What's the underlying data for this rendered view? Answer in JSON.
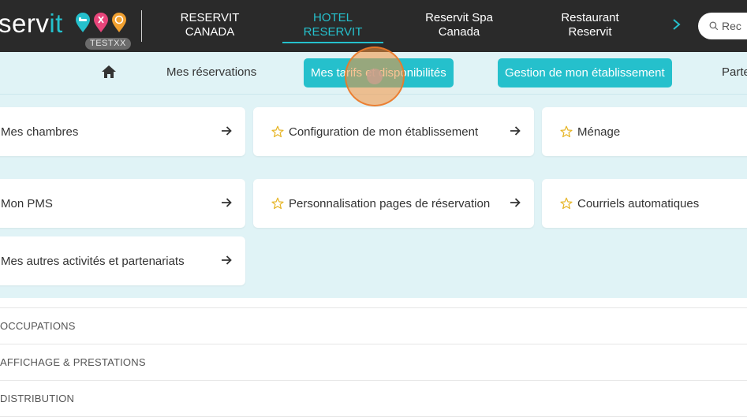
{
  "header": {
    "logo_text_main": "serv",
    "logo_text_accent": "it",
    "badge": "TESTXX",
    "nav": [
      {
        "line1": "RESERVIT",
        "line2": "CANADA",
        "active": false
      },
      {
        "line1": "HOTEL",
        "line2": "RESERVIT",
        "active": true
      },
      {
        "line1": "Reservit Spa",
        "line2": "Canada",
        "active": false
      },
      {
        "line1": "Restaurant",
        "line2": "Reservit",
        "active": false
      }
    ],
    "search_placeholder": "Rec",
    "colors": {
      "bar": "#2a2a2a",
      "accent": "#25c0cc"
    }
  },
  "subnav": {
    "home_icon": "home-icon",
    "my_reservations": "Mes réservations",
    "rates": "Mes tarifs et disponibilités",
    "management": "Gestion de mon établissement",
    "partners": "Parte"
  },
  "cards": [
    {
      "label": "Mes chambres",
      "star": false
    },
    {
      "label": "Configuration de mon établissement",
      "star": true
    },
    {
      "label": "Ménage",
      "star": true
    },
    {
      "label": "Mon PMS",
      "star": false
    },
    {
      "label": "Personnalisation pages de réservation",
      "star": true
    },
    {
      "label": "Courriels automatiques",
      "star": true
    },
    {
      "label": "Mes autres activités et partenariats",
      "star": false
    }
  ],
  "sections": [
    "OCCUPATIONS",
    "AFFICHAGE & PRESTATIONS",
    "DISTRIBUTION"
  ]
}
